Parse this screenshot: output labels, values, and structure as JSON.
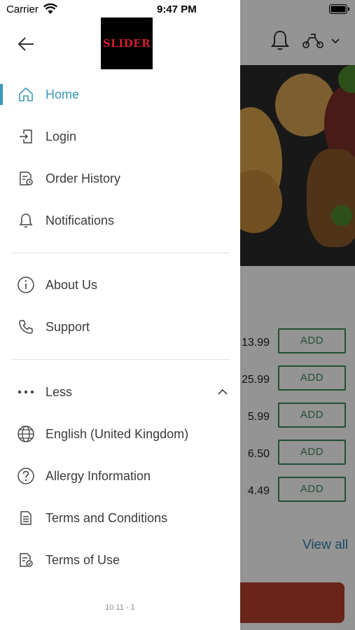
{
  "status_bar": {
    "carrier": "Carrier",
    "time": "9:47 PM"
  },
  "drawer": {
    "logo_text": "SLIDER",
    "menu_primary": [
      {
        "label": "Home",
        "icon": "home-icon",
        "active": true
      },
      {
        "label": "Login",
        "icon": "login-icon"
      },
      {
        "label": "Order History",
        "icon": "order-history-icon"
      },
      {
        "label": "Notifications",
        "icon": "bell-icon"
      }
    ],
    "menu_secondary": [
      {
        "label": "About Us",
        "icon": "info-icon"
      },
      {
        "label": "Support",
        "icon": "phone-icon"
      }
    ],
    "less_label": "Less",
    "menu_more": [
      {
        "label": "English (United Kingdom)",
        "icon": "globe-icon"
      },
      {
        "label": "Allergy Information",
        "icon": "question-icon"
      },
      {
        "label": "Terms and Conditions",
        "icon": "document-icon"
      },
      {
        "label": "Terms of Use",
        "icon": "document-check-icon"
      }
    ],
    "version": "10.11 - 1"
  },
  "background": {
    "prices": [
      "13.99",
      "25.99",
      "5.99",
      "6.50",
      "4.49"
    ],
    "add_label": "ADD",
    "view_all": "View all"
  },
  "colors": {
    "accent": "#3a99b8",
    "add_green": "#3c8a5a",
    "cta": "#b5402e"
  }
}
